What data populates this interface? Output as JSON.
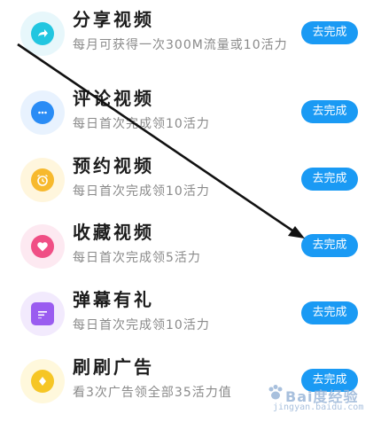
{
  "tasks": [
    {
      "title": "分享视频",
      "desc": "每月可获得一次300M流量或10活力",
      "button": "去完成",
      "icon": "share-arrow-icon",
      "bg": "#e7f7fb",
      "fg": "#22c6e0"
    },
    {
      "title": "评论视频",
      "desc": "每日首次完成领10活力",
      "button": "去完成",
      "icon": "comment-bubble-icon",
      "bg": "#e8f2fe",
      "fg": "#2a8cf5"
    },
    {
      "title": "预约视频",
      "desc": "每日首次完成领10活力",
      "button": "去完成",
      "icon": "alarm-clock-icon",
      "bg": "#fff6dd",
      "fg": "#f7b92d"
    },
    {
      "title": "收藏视频",
      "desc": "每日首次完成领5活力",
      "button": "去完成",
      "icon": "heart-icon",
      "bg": "#fde9f1",
      "fg": "#f04f85"
    },
    {
      "title": "弹幕有礼",
      "desc": "每日首次完成领10活力",
      "button": "去完成",
      "icon": "danmaku-icon",
      "bg": "#f2eafd",
      "fg": "#9a5cf0"
    },
    {
      "title": "刷刷广告",
      "desc": "看3次广告领全部35活力值",
      "button": "去完成",
      "icon": "coin-icon",
      "bg": "#fff8dc",
      "fg": "#f6c625"
    }
  ],
  "watermark": {
    "text": "Bai度经验",
    "sub": "jingyan.baidu.com"
  },
  "colors": {
    "button": "#1a9af4",
    "arrow": "#111111"
  }
}
